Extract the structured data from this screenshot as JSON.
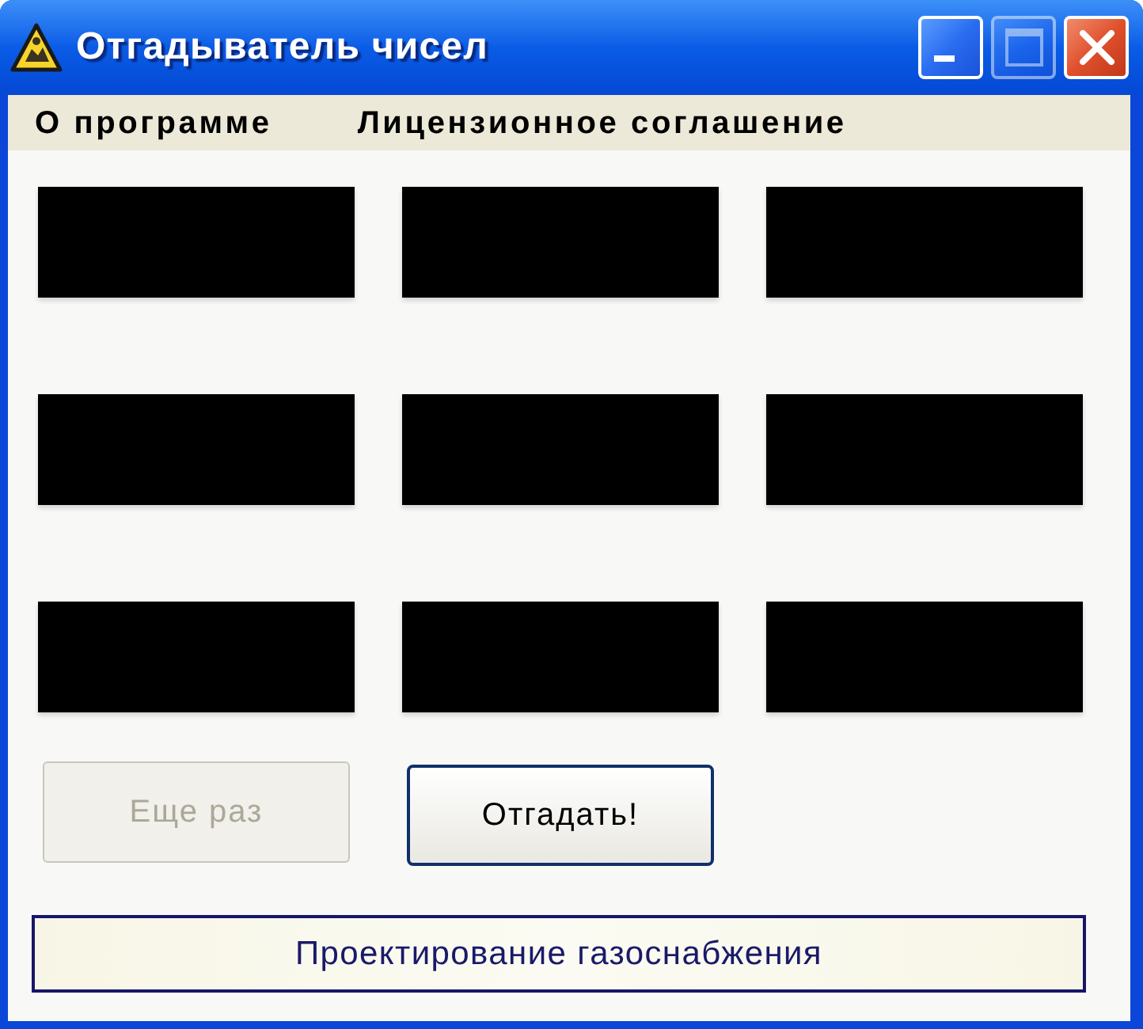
{
  "window": {
    "title": "Отгадыватель чисел",
    "controls": [
      {
        "kind": "minimize",
        "disabled": false
      },
      {
        "kind": "maximize",
        "disabled": true
      },
      {
        "kind": "close",
        "disabled": false
      }
    ]
  },
  "menu": [
    {
      "label": "О программе"
    },
    {
      "label": "Лицензионное соглашение"
    }
  ],
  "panels": [
    {
      "kind": "blank"
    },
    {
      "kind": "blank"
    },
    {
      "kind": "blank"
    },
    {
      "kind": "blank"
    },
    {
      "kind": "blank"
    },
    {
      "kind": "blank"
    },
    {
      "kind": "blank"
    },
    {
      "kind": "blank"
    },
    {
      "kind": "blank"
    }
  ],
  "buttons": [
    {
      "label": "Еще раз",
      "disabled": true
    },
    {
      "label": "Отгадать!",
      "disabled": false
    }
  ],
  "status": {
    "text": "Проектирование газоснабжения"
  }
}
